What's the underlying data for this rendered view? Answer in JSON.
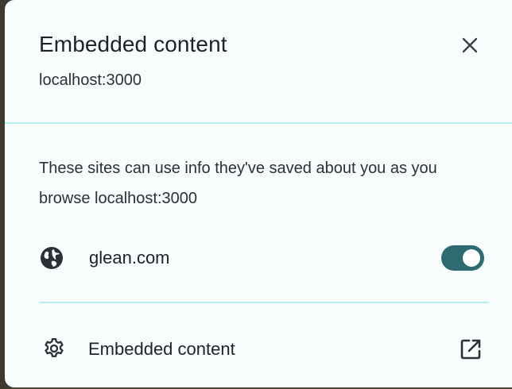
{
  "dialog": {
    "title": "Embedded content",
    "subtitle": "localhost:3000",
    "close_icon": "close-icon"
  },
  "description": "These sites can use info they've saved about you as you browse localhost:3000",
  "sites": [
    {
      "name": "glean.com",
      "icon": "globe-icon",
      "allowed": true
    }
  ],
  "footer": {
    "label": "Embedded content",
    "left_icon": "gear-icon",
    "right_icon": "external-link-icon"
  },
  "colors": {
    "panel_bg": "#f7fcfd",
    "divider": "#b7ecf3",
    "toggle_on": "#2e6b70",
    "text": "#1d2427"
  }
}
